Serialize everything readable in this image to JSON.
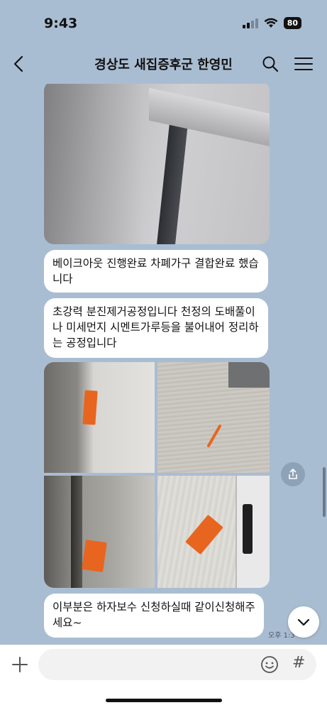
{
  "status_bar": {
    "time": "9:43",
    "battery": "80",
    "icons": [
      "signal-icon",
      "wifi-icon",
      "battery-icon"
    ]
  },
  "header": {
    "title": "경상도 새집증후군 한영민",
    "icons": [
      "back-arrow-icon",
      "search-icon",
      "menu-icon"
    ]
  },
  "messages": [
    {
      "type": "image",
      "description_icon": "photo"
    },
    {
      "type": "text",
      "text": "베이크아웃 진행완료 차폐가구 결합완료 했습니다"
    },
    {
      "type": "text",
      "text": "초강력 분진제거공정입니다 천정의 도배풀이나 미세먼지 시멘트가루등을 불어내어 정리하는 공정입니다"
    },
    {
      "type": "image-grid",
      "count": 4
    },
    {
      "type": "text",
      "text": "이부분은 하자보수 신청하실때 같이신청해주세요~"
    }
  ],
  "timestamp": "오후 1:3",
  "input": {
    "placeholder": "",
    "icons": [
      "plus-icon",
      "emoji-icon",
      "hash-icon"
    ],
    "hash_symbol": "#"
  },
  "colors": {
    "background": "#a9bdd2",
    "bubble": "#ffffff",
    "tape": "#e8651f"
  }
}
